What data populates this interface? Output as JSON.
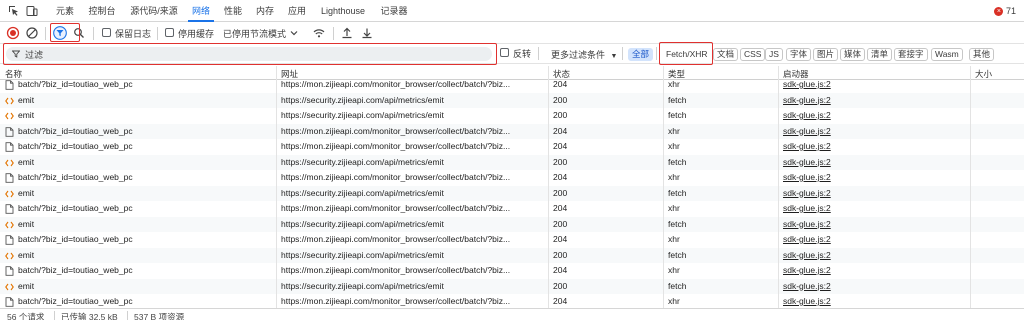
{
  "tabs": {
    "elements": "元素",
    "console": "控制台",
    "sources": "源代码/来源",
    "network": "网络",
    "performance": "性能",
    "memory": "内存",
    "application": "应用",
    "lighthouse": "Lighthouse",
    "recorder": "记录器"
  },
  "issues_count": "71",
  "toolbar": {
    "preserve_log": "保留日志",
    "disable_cache": "停用缓存",
    "throttling": "已停用节流模式"
  },
  "filter": {
    "placeholder": "过滤",
    "invert": "反转",
    "more_filters": "更多过滤条件",
    "chips": [
      "全部",
      "Fetch/XHR",
      "文档",
      "CSS",
      "JS",
      "字体",
      "图片",
      "媒体",
      "清单",
      "套接字",
      "Wasm",
      "其他"
    ]
  },
  "table": {
    "headers": [
      "名称",
      "网址",
      "状态",
      "类型",
      "启动器",
      "大小"
    ],
    "rows": [
      {
        "name": "batch/?biz_id=toutiao_web_pc",
        "url": "https://mon.zijieapi.com/monitor_browser/collect/batch/?biz...",
        "status": "204",
        "type": "xhr",
        "initiator": "sdk-glue.js:2",
        "kind": "doc"
      },
      {
        "name": "emit",
        "url": "https://security.zijieapi.com/api/metrics/emit",
        "status": "200",
        "type": "fetch",
        "initiator": "sdk-glue.js:2",
        "kind": "fetch"
      },
      {
        "name": "emit",
        "url": "https://security.zijieapi.com/api/metrics/emit",
        "status": "200",
        "type": "fetch",
        "initiator": "sdk-glue.js:2",
        "kind": "fetch"
      },
      {
        "name": "batch/?biz_id=toutiao_web_pc",
        "url": "https://mon.zijieapi.com/monitor_browser/collect/batch/?biz...",
        "status": "204",
        "type": "xhr",
        "initiator": "sdk-glue.js:2",
        "kind": "doc"
      },
      {
        "name": "batch/?biz_id=toutiao_web_pc",
        "url": "https://mon.zijieapi.com/monitor_browser/collect/batch/?biz...",
        "status": "204",
        "type": "xhr",
        "initiator": "sdk-glue.js:2",
        "kind": "doc"
      },
      {
        "name": "emit",
        "url": "https://security.zijieapi.com/api/metrics/emit",
        "status": "200",
        "type": "fetch",
        "initiator": "sdk-glue.js:2",
        "kind": "fetch"
      },
      {
        "name": "batch/?biz_id=toutiao_web_pc",
        "url": "https://mon.zijieapi.com/monitor_browser/collect/batch/?biz...",
        "status": "204",
        "type": "xhr",
        "initiator": "sdk-glue.js:2",
        "kind": "doc"
      },
      {
        "name": "emit",
        "url": "https://security.zijieapi.com/api/metrics/emit",
        "status": "200",
        "type": "fetch",
        "initiator": "sdk-glue.js:2",
        "kind": "fetch"
      },
      {
        "name": "batch/?biz_id=toutiao_web_pc",
        "url": "https://mon.zijieapi.com/monitor_browser/collect/batch/?biz...",
        "status": "204",
        "type": "xhr",
        "initiator": "sdk-glue.js:2",
        "kind": "doc"
      },
      {
        "name": "emit",
        "url": "https://security.zijieapi.com/api/metrics/emit",
        "status": "200",
        "type": "fetch",
        "initiator": "sdk-glue.js:2",
        "kind": "fetch"
      },
      {
        "name": "batch/?biz_id=toutiao_web_pc",
        "url": "https://mon.zijieapi.com/monitor_browser/collect/batch/?biz...",
        "status": "204",
        "type": "xhr",
        "initiator": "sdk-glue.js:2",
        "kind": "doc"
      },
      {
        "name": "emit",
        "url": "https://security.zijieapi.com/api/metrics/emit",
        "status": "200",
        "type": "fetch",
        "initiator": "sdk-glue.js:2",
        "kind": "fetch"
      },
      {
        "name": "batch/?biz_id=toutiao_web_pc",
        "url": "https://mon.zijieapi.com/monitor_browser/collect/batch/?biz...",
        "status": "204",
        "type": "xhr",
        "initiator": "sdk-glue.js:2",
        "kind": "doc"
      },
      {
        "name": "emit",
        "url": "https://security.zijieapi.com/api/metrics/emit",
        "status": "200",
        "type": "fetch",
        "initiator": "sdk-glue.js:2",
        "kind": "fetch"
      },
      {
        "name": "batch/?biz_id=toutiao_web_pc",
        "url": "https://mon.zijieapi.com/monitor_browser/collect/batch/?biz...",
        "status": "204",
        "type": "xhr",
        "initiator": "sdk-glue.js:2",
        "kind": "doc"
      }
    ]
  },
  "status_bar": {
    "requests": "56 个请求",
    "transferred": "已传输 32.5 kB",
    "resources": "537 B 项资源"
  },
  "colors": {
    "accent": "#1a73e8",
    "record_red": "#d93025",
    "annotation_red": "#e0312f",
    "fetch_orange": "#e37400"
  }
}
